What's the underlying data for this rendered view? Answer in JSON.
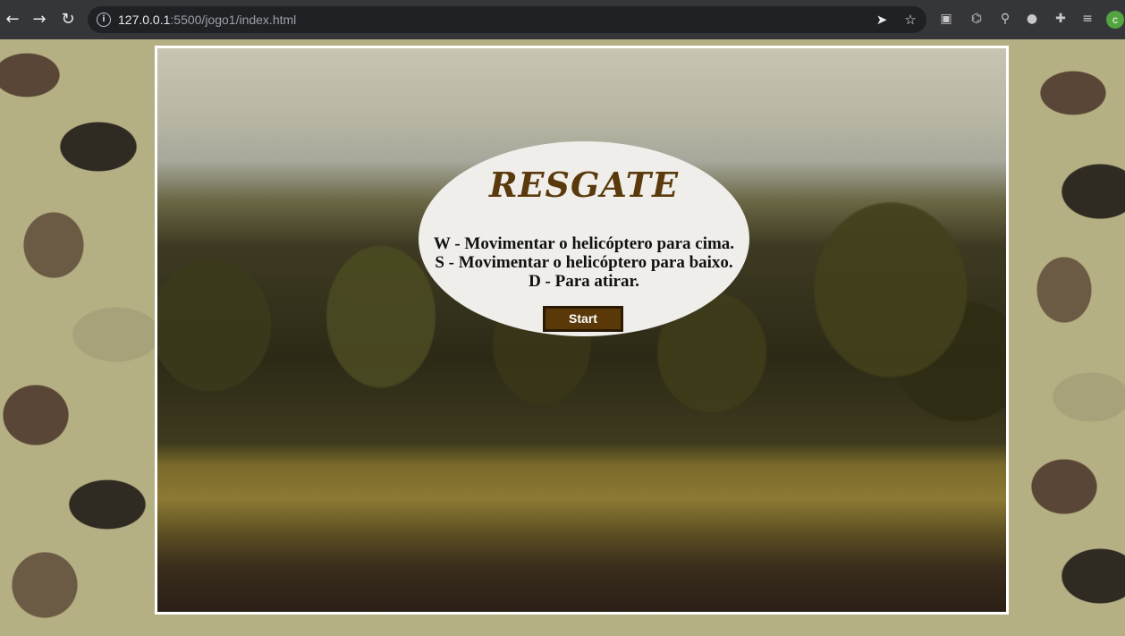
{
  "browser": {
    "url_host": "127.0.0.1",
    "url_path": ":5500/jogo1/index.html",
    "profile_initial": "c",
    "icons": {
      "back": "arrow-left-icon",
      "forward": "arrow-right-icon",
      "reload": "reload-icon",
      "info": "info-icon",
      "send": "send-icon",
      "bookmark": "star-icon",
      "extensions": [
        "extension-json-icon",
        "extension-code-icon",
        "extension-search-icon",
        "extension-cookie-icon",
        "puzzle-icon",
        "media-queue-icon"
      ]
    }
  },
  "game": {
    "title": "RESGATE",
    "instructions": [
      "W - Movimentar o helicóptero para cima.",
      "S - Movimentar o helicóptero para baixo.",
      "D - Para atirar."
    ],
    "start_label": "Start",
    "colors": {
      "title": "#5a3a0c",
      "button_bg": "#5a3808",
      "popup_bg": "#f0eeea",
      "frame_border": "#ffffff"
    }
  }
}
